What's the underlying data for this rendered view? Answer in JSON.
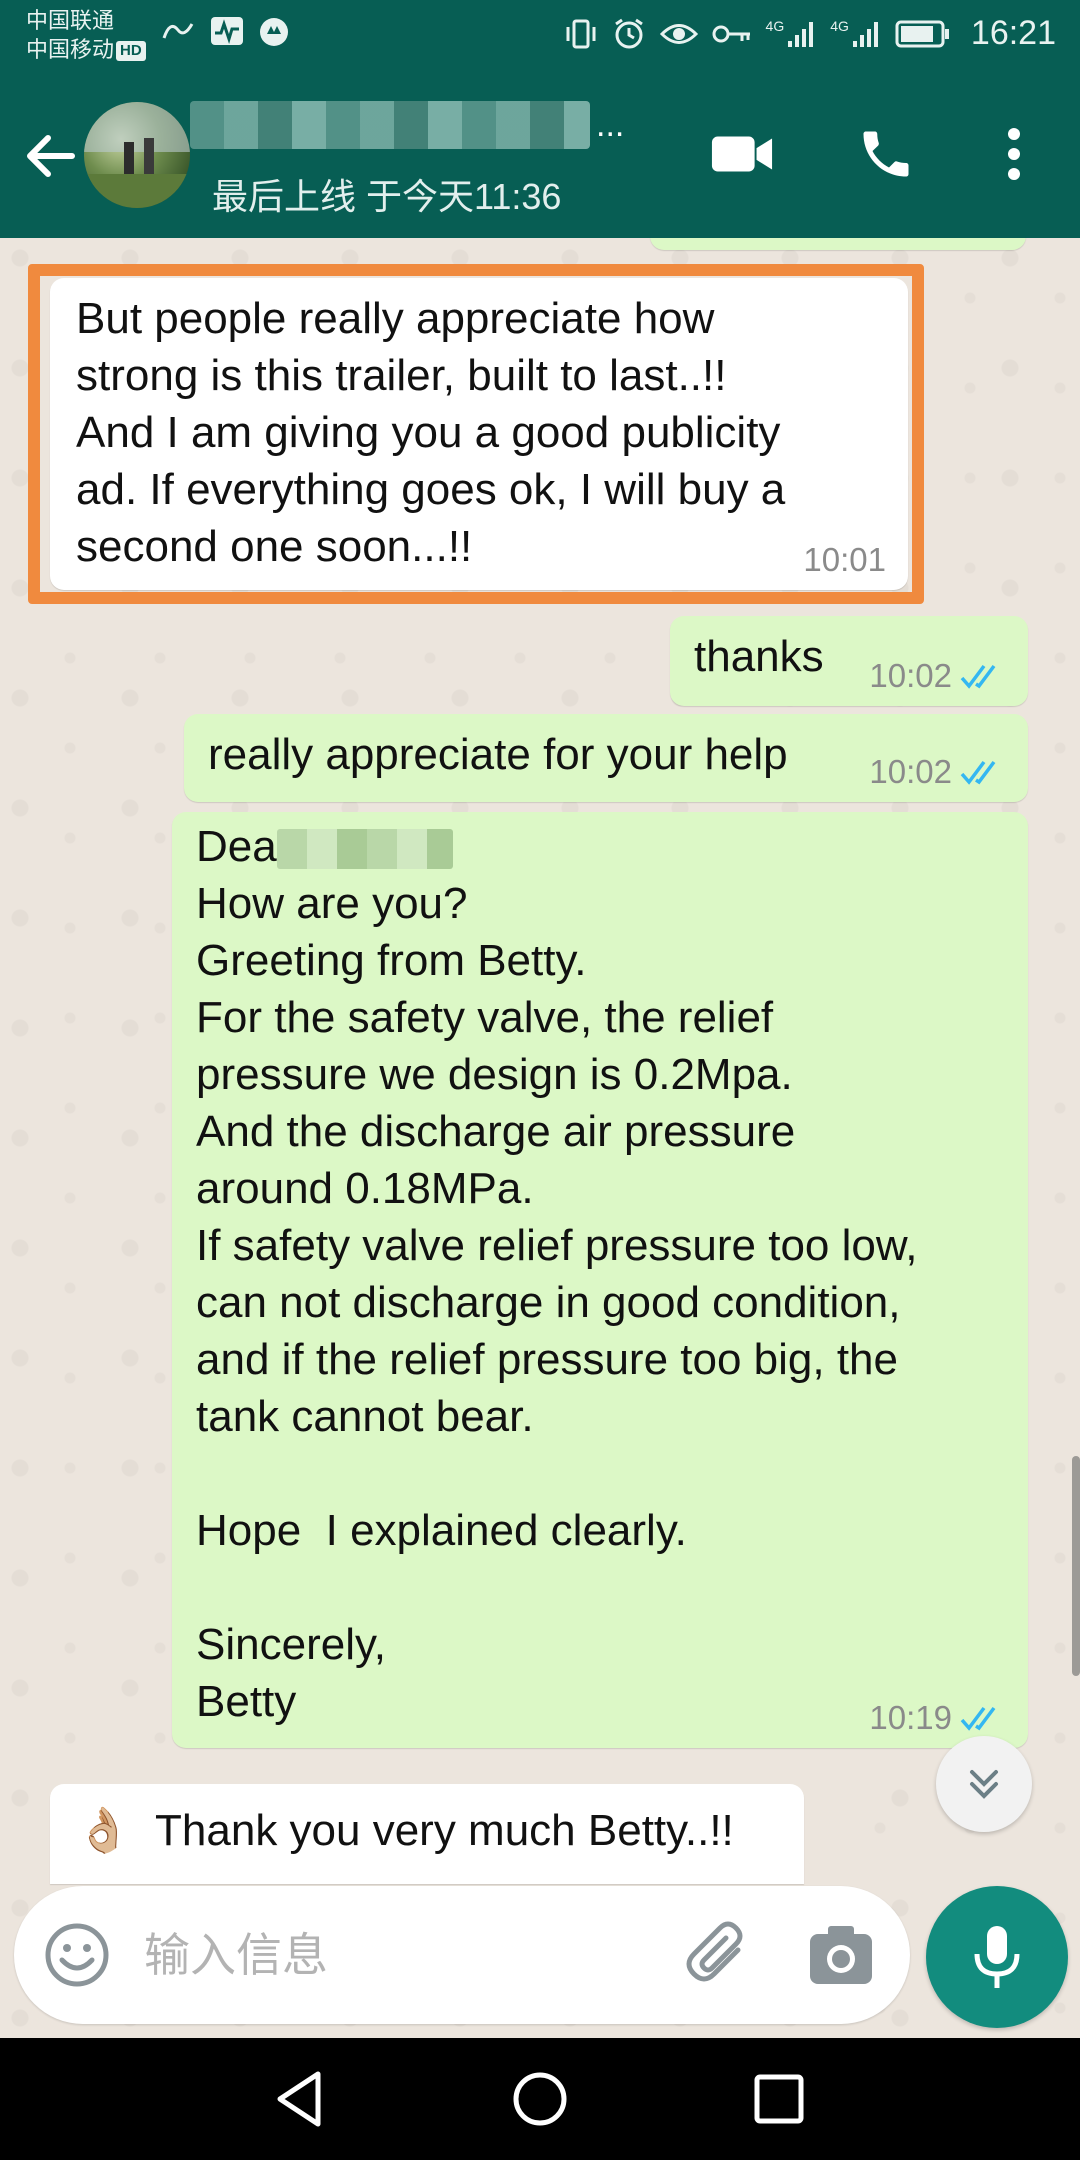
{
  "status_bar": {
    "carrier_1": "中国联通",
    "carrier_2": "中国移动",
    "hd_badge": "HD",
    "network_label": "4G",
    "network_label_2": "4G",
    "time": "16:21"
  },
  "header": {
    "last_seen": "最后上线 于今天11:36",
    "name_ellipsis": "..."
  },
  "messages": [
    {
      "direction": "incoming",
      "text": "But people really appreciate how\nstrong is this trailer, built to last..!!\nAnd I am giving you a good publicity\nad. If everything goes ok, I will buy a\nsecond one soon...!!",
      "time": "10:01",
      "highlighted": true
    },
    {
      "direction": "outgoing",
      "text": "thanks",
      "time": "10:02",
      "status": "read"
    },
    {
      "direction": "outgoing",
      "text": "really appreciate for your help",
      "time": "10:02",
      "status": "read"
    },
    {
      "direction": "outgoing",
      "text_prefix": "Dea",
      "text": "How are you?\nGreeting from Betty.\nFor the safety valve, the relief\npressure we design is 0.2Mpa.\nAnd the discharge air pressure\naround 0.18MPa.\nIf safety valve relief pressure too low,\ncan not discharge in good condition,\nand if the relief pressure too big, the\ntank cannot bear.\n\nHope  I explained clearly.\n\nSincerely,\nBetty",
      "time": "10:19",
      "status": "read"
    },
    {
      "direction": "incoming",
      "emoji": "👌🏼",
      "text": "Thank you very much Betty..!!"
    }
  ],
  "composer": {
    "placeholder": "输入信息"
  },
  "colors": {
    "header_bg": "#075e54",
    "outgoing_bubble": "#dcf8c6",
    "incoming_bubble": "#ffffff",
    "read_ticks": "#34b7f1",
    "highlight_border": "#f08a3e",
    "mic_button": "#128c7e"
  },
  "icons": [
    "back-arrow-icon",
    "video-call-icon",
    "phone-icon",
    "more-options-icon",
    "emoji-icon",
    "attach-icon",
    "camera-icon",
    "mic-icon",
    "scroll-down-icon",
    "nav-back-icon",
    "nav-home-icon",
    "nav-recents-icon"
  ]
}
